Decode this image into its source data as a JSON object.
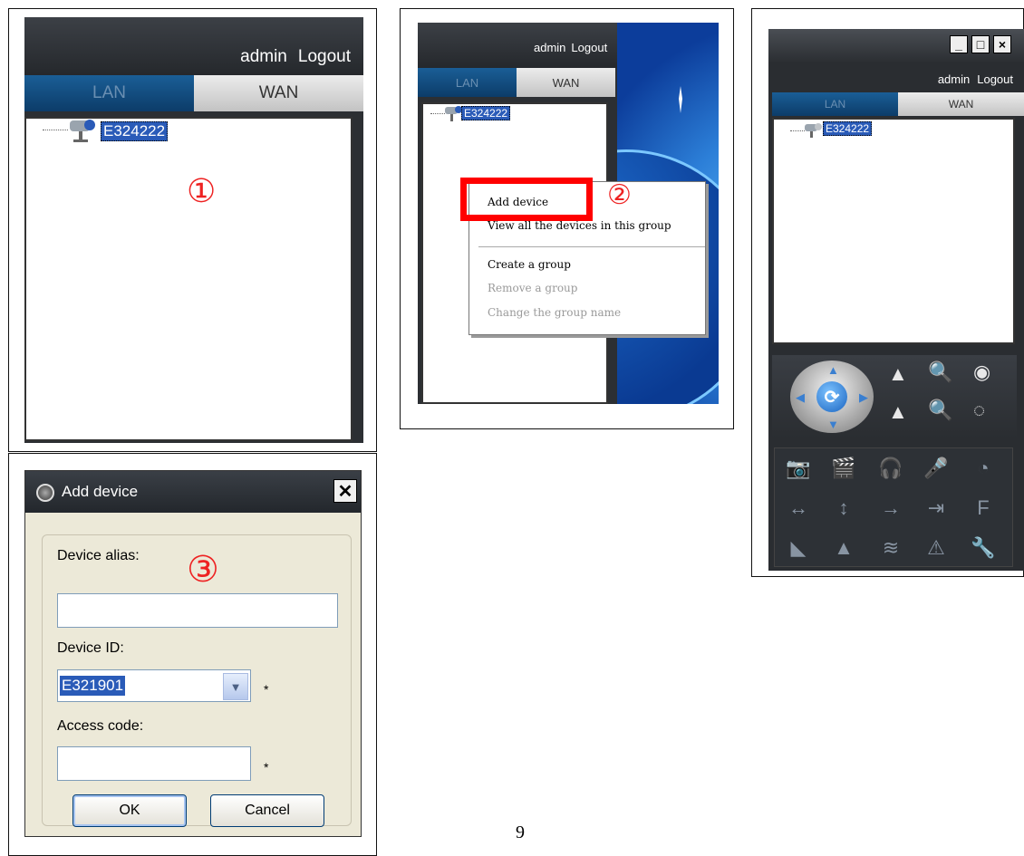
{
  "panel1": {
    "user": "admin",
    "logout": "Logout",
    "tabs": [
      "LAN",
      "WAN"
    ],
    "device": "E324222",
    "marker": "①"
  },
  "panel2": {
    "user": "admin",
    "logout": "Logout",
    "tabs": [
      "LAN",
      "WAN"
    ],
    "device": "E324222",
    "marker": "②",
    "context_menu": {
      "items": [
        {
          "label": "Add device",
          "enabled": true
        },
        {
          "label": "View all the devices in this group",
          "enabled": true
        },
        {
          "label": "Create a group",
          "enabled": true
        },
        {
          "label": "Remove a group",
          "enabled": false
        },
        {
          "label": "Change the group name",
          "enabled": false
        }
      ]
    }
  },
  "panel3": {
    "window_buttons": [
      "_",
      "□",
      "×"
    ],
    "user": "admin",
    "logout": "Logout",
    "tabs": [
      "LAN",
      "WAN"
    ],
    "device": "E324222",
    "ptz_icons": [
      "zoom-in-triangle-icon",
      "zoom-out-magnifier-icon",
      "focus-in-icon",
      "focus-out-icon",
      "iris-open-icon",
      "iris-close-icon"
    ],
    "tool_icons": [
      "snapshot-icon",
      "record-icon",
      "audio-icon",
      "talk-icon",
      "playback-icon",
      "horizontal-patrol-icon",
      "vertical-patrol-icon",
      "preset-icon",
      "input-icon",
      "flip-icon",
      "mirror-icon",
      "triangle-icon",
      "wifi-icon",
      "alarm-icon",
      "settings-icon"
    ]
  },
  "panel4": {
    "title": "Add device",
    "marker": "③",
    "alias_label": "Device alias:",
    "alias_value": "",
    "id_label": "Device ID:",
    "id_value": "E321901",
    "access_label": "Access code:",
    "access_value": "",
    "required_mark": "*",
    "ok": "OK",
    "cancel": "Cancel"
  },
  "page_number": "9"
}
